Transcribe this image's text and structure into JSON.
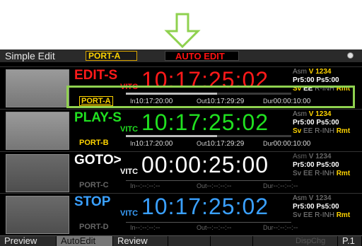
{
  "arrow": {
    "color": "#8fd14f"
  },
  "topbar": {
    "mode_title": "Simple Edit",
    "port_chip": "PORT-A",
    "auto_edit": "AUTO EDIT"
  },
  "rows": [
    {
      "status": "EDIT-S",
      "status_color": "#ff1a1a",
      "vitc": "VITC",
      "timecode": "10:17:25:02",
      "tc_color": "#ff1a1a",
      "port": "PORT-A",
      "port_color": "#ffd400",
      "port_boxed": true,
      "in_tag": "In",
      "in": "10:17:20:00",
      "out_tag": "Out",
      "out": "10:17:29:29",
      "dur_tag": "Dur",
      "dur": "00:00:10:00",
      "asm": "Asm",
      "v": "V 1234",
      "pr": "Pr5:00",
      "ps": "Ps5:00",
      "sv": "Sv",
      "ee": "EE",
      "rinh": "R-INH",
      "rmt": "Rmt",
      "progress": 0.55
    },
    {
      "status": "PLAY-S",
      "status_color": "#20e020",
      "vitc": "VITC",
      "timecode": "10:17:25:02",
      "tc_color": "#20e020",
      "port": "PORT-B",
      "port_color": "#ffd400",
      "port_boxed": false,
      "in_tag": "In",
      "in": "10:17:20:00",
      "out_tag": "Out",
      "out": "10:17:29:29",
      "dur_tag": "Dur",
      "dur": "00:00:10:00",
      "asm": "Asm",
      "v": "V 1234",
      "pr": "Pr5:00",
      "ps": "Ps5:00",
      "sv": "Sv",
      "ee": "EE",
      "rinh": "R-INH",
      "rmt": "Rmt",
      "progress": 0.55
    },
    {
      "status": "GOTO>",
      "status_color": "#ffffff",
      "vitc": "VITC",
      "timecode": "00:00:25:00",
      "tc_color": "#ffffff",
      "port": "PORT-C",
      "port_color": "#666666",
      "port_boxed": false,
      "in_tag": "In",
      "in": "--:--:--:--",
      "out_tag": "Out",
      "out": "--:--:--:--",
      "dur_tag": "Dur",
      "dur": "--:--:--:--",
      "asm": "Asm",
      "v": "V 1234",
      "pr": "Pr5:00",
      "ps": "Ps5:00",
      "sv": "Sv",
      "ee": "EE",
      "rinh": "R-INH",
      "rmt": "Rmt",
      "progress": 0
    },
    {
      "status": "STOP",
      "status_color": "#3aa0ff",
      "vitc": "VITC",
      "timecode": "10:17:25:02",
      "tc_color": "#3aa0ff",
      "port": "PORT-D",
      "port_color": "#666666",
      "port_boxed": false,
      "in_tag": "In",
      "in": "--:--:--:--",
      "out_tag": "Out",
      "out": "--:--:--:--",
      "dur_tag": "Dur",
      "dur": "--:--:--:--",
      "asm": "Asm",
      "v": "V 1234",
      "pr": "Pr5:00",
      "ps": "Ps5:00",
      "sv": "Sv",
      "ee": "EE",
      "rinh": "R-INH",
      "rmt": "Rmt",
      "progress": 0
    }
  ],
  "bottombar": {
    "preview": "Preview",
    "autoedit": "AutoEdit",
    "review": "Review",
    "dispchg": "DispChg",
    "page": "P.1"
  }
}
